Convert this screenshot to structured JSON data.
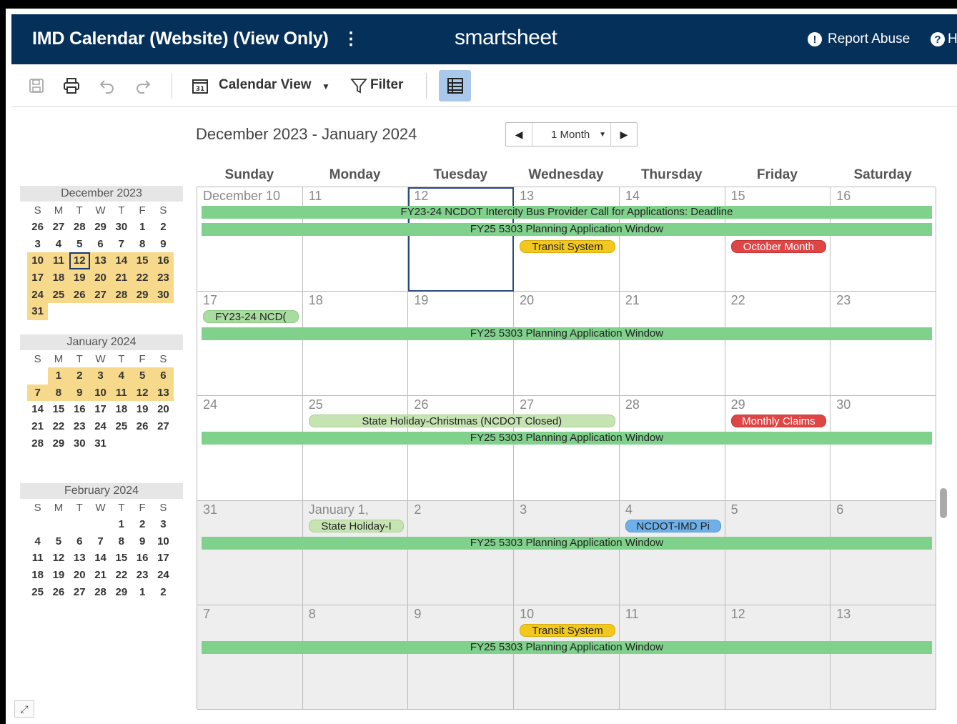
{
  "header": {
    "title": "IMD Calendar (Website) (View Only)",
    "kebab": "⋮",
    "brand": "smartsheet",
    "report_abuse": "Report Abuse",
    "help": "H"
  },
  "toolbar": {
    "calendar_view_label": "Calendar View",
    "filter_label": "Filter"
  },
  "range": {
    "title": "December 2023 - January 2024",
    "period_select": "1 Month"
  },
  "days_of_week": [
    "Sunday",
    "Monday",
    "Tuesday",
    "Wednesday",
    "Thursday",
    "Friday",
    "Saturday"
  ],
  "mini_dow": [
    "S",
    "M",
    "T",
    "W",
    "T",
    "F",
    "S"
  ],
  "mini_calendars": [
    {
      "title": "December 2023",
      "weeks": [
        [
          "26",
          "27",
          "28",
          "29",
          "30",
          "1",
          "2"
        ],
        [
          "3",
          "4",
          "5",
          "6",
          "7",
          "8",
          "9"
        ],
        [
          "10",
          "11",
          "12",
          "13",
          "14",
          "15",
          "16"
        ],
        [
          "17",
          "18",
          "19",
          "20",
          "21",
          "22",
          "23"
        ],
        [
          "24",
          "25",
          "26",
          "27",
          "28",
          "29",
          "30"
        ],
        [
          "31",
          "",
          "",
          "",
          "",
          "",
          ""
        ]
      ]
    },
    {
      "title": "January 2024",
      "weeks": [
        [
          "",
          "1",
          "2",
          "3",
          "4",
          "5",
          "6"
        ],
        [
          "7",
          "8",
          "9",
          "10",
          "11",
          "12",
          "13"
        ],
        [
          "14",
          "15",
          "16",
          "17",
          "18",
          "19",
          "20"
        ],
        [
          "21",
          "22",
          "23",
          "24",
          "25",
          "26",
          "27"
        ],
        [
          "28",
          "29",
          "30",
          "31",
          "",
          "",
          ""
        ]
      ]
    },
    {
      "title": "February 2024",
      "weeks": [
        [
          "",
          "",
          "",
          "",
          "1",
          "2",
          "3"
        ],
        [
          "4",
          "5",
          "6",
          "7",
          "8",
          "9",
          "10"
        ],
        [
          "11",
          "12",
          "13",
          "14",
          "15",
          "16",
          "17"
        ],
        [
          "18",
          "19",
          "20",
          "21",
          "22",
          "23",
          "24"
        ],
        [
          "25",
          "26",
          "27",
          "28",
          "29",
          "1",
          "2"
        ]
      ]
    }
  ],
  "weeks": [
    {
      "days": [
        "December 10",
        "11",
        "12",
        "13",
        "14",
        "15",
        "16"
      ],
      "events": [
        {
          "label": "FY23-24 NCDOT Intercity Bus Provider Call for Applications: Deadline",
          "type": "bar"
        },
        {
          "label": "FY25 5303 Planning Application Window",
          "type": "bar"
        },
        {
          "label": "Transit System",
          "type": "yellow"
        },
        {
          "label": "October Month",
          "type": "red"
        }
      ]
    },
    {
      "days": [
        "17",
        "18",
        "19",
        "20",
        "21",
        "22",
        "23"
      ],
      "events": [
        {
          "label": "FY23-24 NCD(",
          "type": "green"
        },
        {
          "label": "FY25 5303 Planning Application Window",
          "type": "bar"
        }
      ]
    },
    {
      "days": [
        "24",
        "25",
        "26",
        "27",
        "28",
        "29",
        "30"
      ],
      "events": [
        {
          "label": "State Holiday-Christmas (NCDOT Closed)",
          "type": "green-light"
        },
        {
          "label": "Monthly Claims",
          "type": "red"
        },
        {
          "label": "FY25 5303 Planning Application Window",
          "type": "bar"
        }
      ]
    },
    {
      "days": [
        "31",
        "January 1,",
        "2",
        "3",
        "4",
        "5",
        "6"
      ],
      "events": [
        {
          "label": "State Holiday-I",
          "type": "green-light"
        },
        {
          "label": "NCDOT-IMD Pi",
          "type": "blue"
        },
        {
          "label": "FY25 5303 Planning Application Window",
          "type": "bar"
        }
      ]
    },
    {
      "days": [
        "7",
        "8",
        "9",
        "10",
        "11",
        "12",
        "13"
      ],
      "events": [
        {
          "label": "Transit System",
          "type": "yellow"
        },
        {
          "label": "FY25 5303 Planning Application Window",
          "type": "bar"
        }
      ]
    }
  ]
}
